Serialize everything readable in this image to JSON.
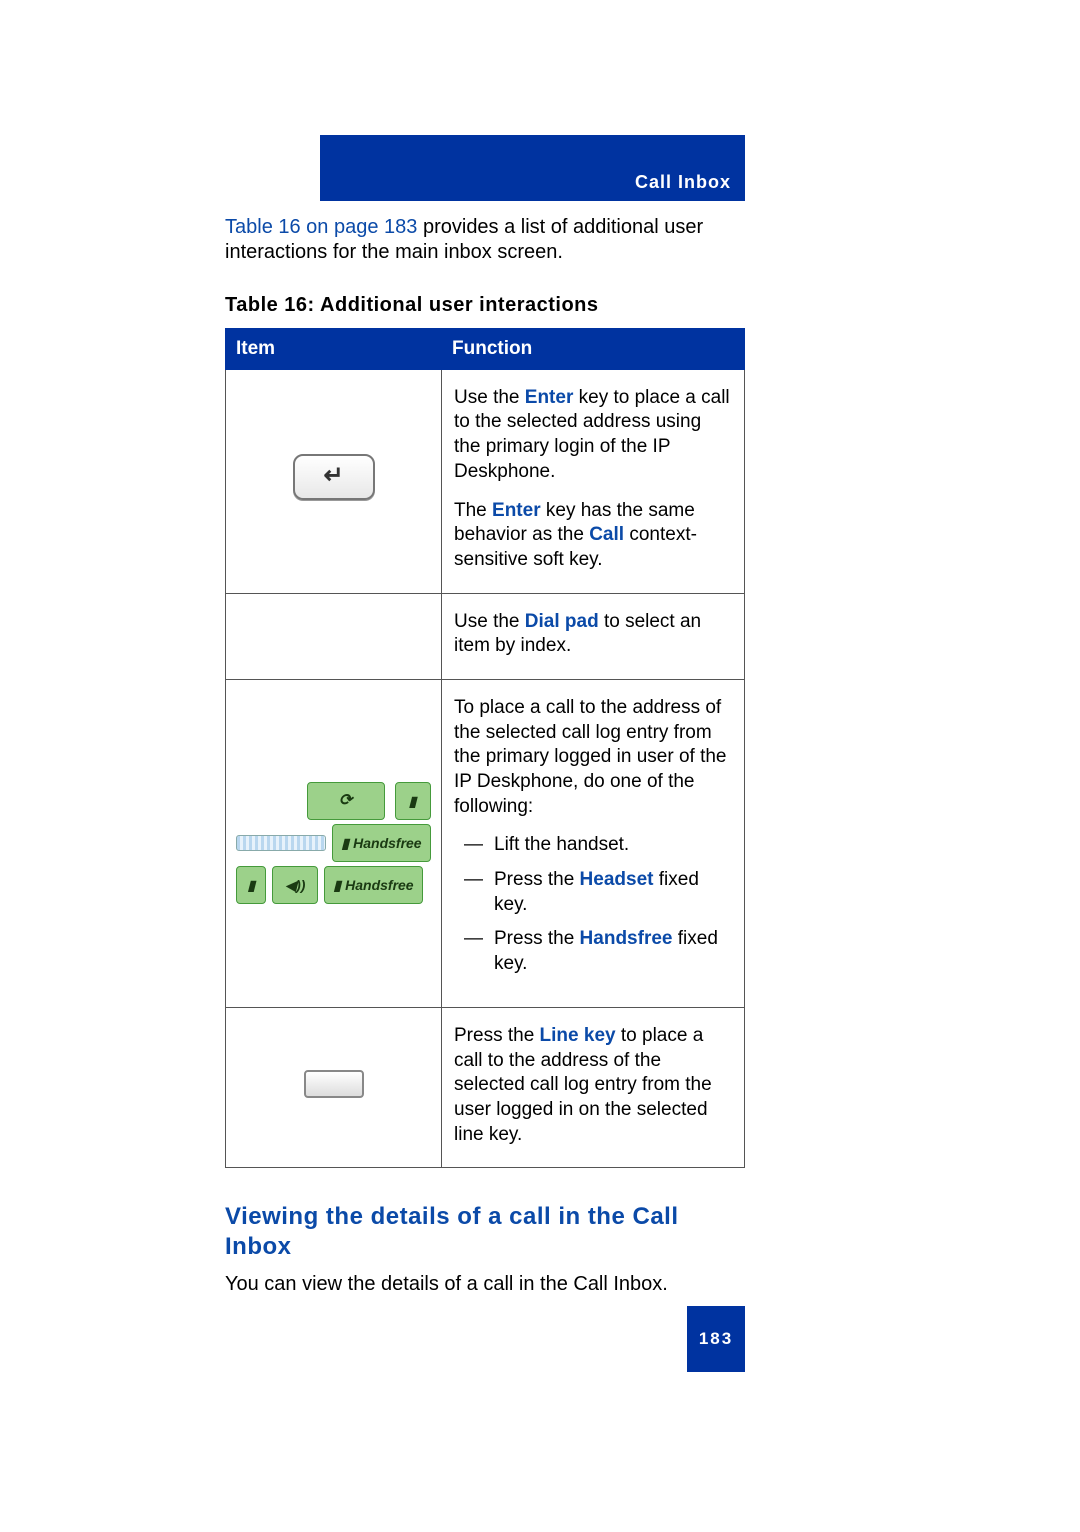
{
  "header": {
    "section_label": "Call Inbox"
  },
  "intro": {
    "link_text": "Table 16 on page 183",
    "rest": " provides a list of additional user interactions for the main inbox screen."
  },
  "table": {
    "caption": "Table 16: Additional user interactions",
    "headers": {
      "item": "Item",
      "function": "Function"
    },
    "rows": [
      {
        "icon": "enter-key",
        "function_parts": {
          "p1_a": "Use the ",
          "p1_b": "Enter",
          "p1_c": " key to place a call to the selected address using the primary login of the IP Deskphone.",
          "p2_a": "The ",
          "p2_b": "Enter",
          "p2_c": " key has the same behavior as the ",
          "p2_d": "Call",
          "p2_e": " context-sensitive soft key."
        }
      },
      {
        "icon": "",
        "function_parts": {
          "p1_a": "Use the ",
          "p1_b": "Dial pad",
          "p1_c": " to select an item by index."
        }
      },
      {
        "icon": "handsfree-panel",
        "labels": {
          "handsfree": "Handsfree"
        },
        "function_parts": {
          "intro": "To place a call to the address of the selected call log entry from the primary logged in user of the IP Deskphone, do one of the following:",
          "li1": "Lift the handset.",
          "li2_a": "Press the ",
          "li2_b": "Headset",
          "li2_c": " fixed key.",
          "li3_a": "Press the ",
          "li3_b": "Handsfree",
          "li3_c": " fixed key."
        }
      },
      {
        "icon": "line-key",
        "function_parts": {
          "p1_a": "Press the ",
          "p1_b": "Line key",
          "p1_c": " to place a call to the address of the selected call log entry from the user logged in on the selected line key."
        }
      }
    ]
  },
  "section": {
    "heading": "Viewing the details of a call in the Call Inbox",
    "body": "You can view the details of a call in the Call Inbox."
  },
  "page_number": "183"
}
